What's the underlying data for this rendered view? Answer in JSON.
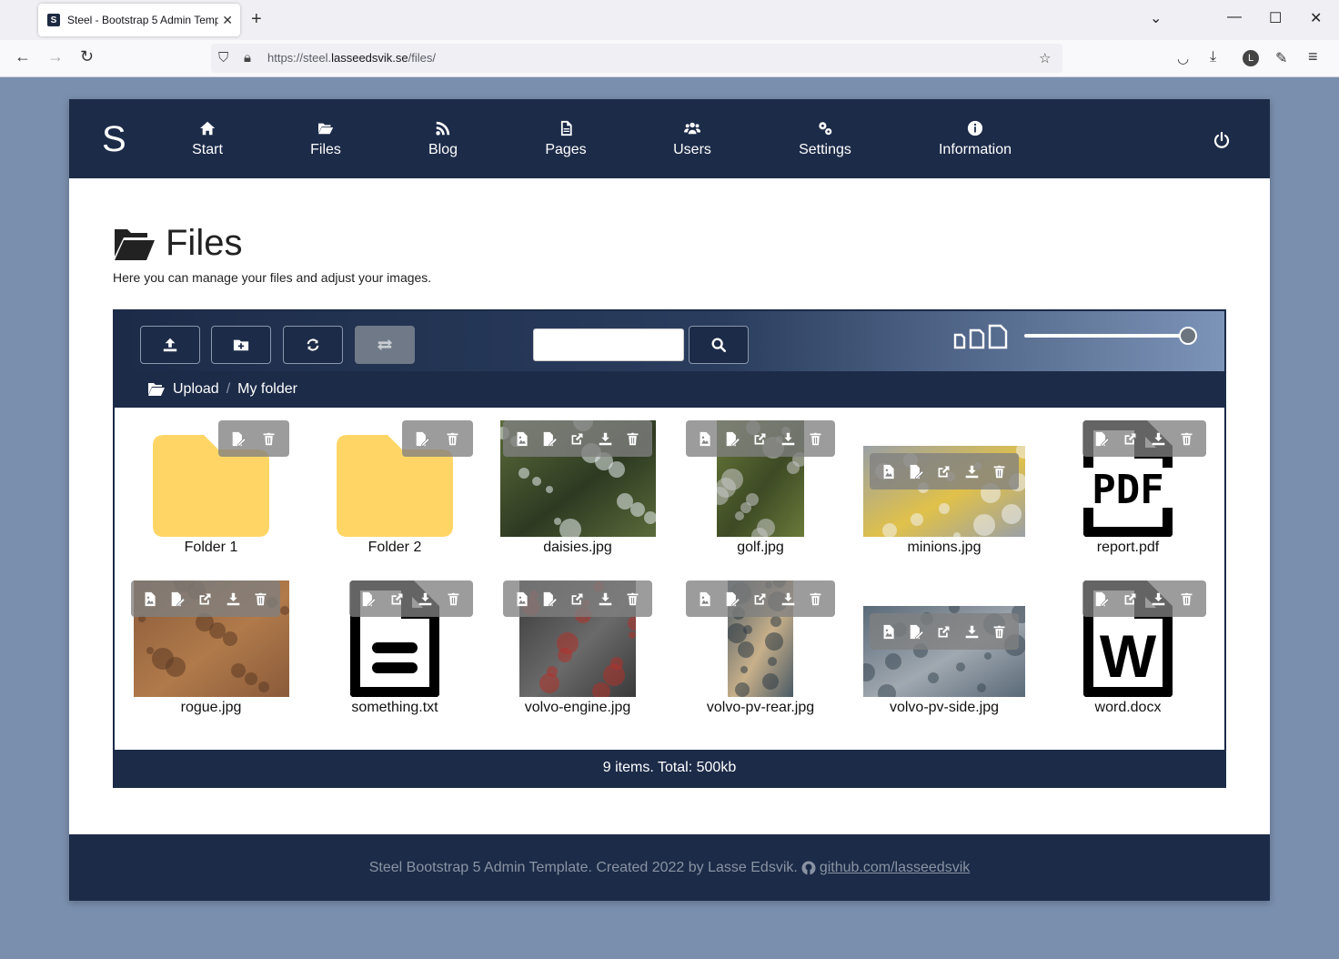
{
  "browser": {
    "tab_title": "Steel - Bootstrap 5 Admin Temp",
    "tab_favicon": "S",
    "url_prefix": "https://steel.",
    "url_domain": "lasseedsvik.se",
    "url_path": "/files/"
  },
  "app": {
    "brand": "S",
    "nav": [
      {
        "label": "Start",
        "icon": "home-icon"
      },
      {
        "label": "Files",
        "icon": "folder-open-icon"
      },
      {
        "label": "Blog",
        "icon": "rss-icon"
      },
      {
        "label": "Pages",
        "icon": "file-icon"
      },
      {
        "label": "Users",
        "icon": "users-icon"
      },
      {
        "label": "Settings",
        "icon": "gears-icon"
      },
      {
        "label": "Information",
        "icon": "info-icon"
      }
    ]
  },
  "page": {
    "title": "Files",
    "subtitle": "Here you can manage your files and adjust your images."
  },
  "file_manager": {
    "search_placeholder": "",
    "zoom_level": 1.0,
    "breadcrumb": [
      "Upload",
      "My folder"
    ],
    "items": [
      {
        "name": "Folder 1",
        "type": "folder"
      },
      {
        "name": "Folder 2",
        "type": "folder"
      },
      {
        "name": "daisies.jpg",
        "type": "image",
        "colors": [
          "#5b6b3a",
          "#e8ecef",
          "#2d3a22"
        ]
      },
      {
        "name": "golf.jpg",
        "type": "image",
        "colors": [
          "#6a7a3a",
          "#c9c9c9",
          "#3d4a25"
        ]
      },
      {
        "name": "minions.jpg",
        "type": "image",
        "colors": [
          "#9aa0a6",
          "#f2f2f2",
          "#e0c14a"
        ]
      },
      {
        "name": "report.pdf",
        "type": "pdf",
        "label": "PDF"
      },
      {
        "name": "rogue.jpg",
        "type": "image",
        "colors": [
          "#8a5a3a",
          "#5c3a24",
          "#b07a4a"
        ]
      },
      {
        "name": "something.txt",
        "type": "text"
      },
      {
        "name": "volvo-engine.jpg",
        "type": "image",
        "colors": [
          "#3a3a3a",
          "#b0322a",
          "#6a6a6a"
        ]
      },
      {
        "name": "volvo-pv-rear.jpg",
        "type": "image",
        "colors": [
          "#4a5a66",
          "#2e3a44",
          "#c8b08a"
        ]
      },
      {
        "name": "volvo-pv-side.jpg",
        "type": "image",
        "colors": [
          "#5a6a78",
          "#3c4a56",
          "#a0a8b0"
        ]
      },
      {
        "name": "word.docx",
        "type": "word",
        "label": "W"
      }
    ],
    "status": "9 items. Total: 500kb"
  },
  "footer": {
    "text": "Steel Bootstrap 5 Admin Template. Created 2022 by Lasse Edsvik.",
    "link": "github.com/lasseedsvik"
  }
}
